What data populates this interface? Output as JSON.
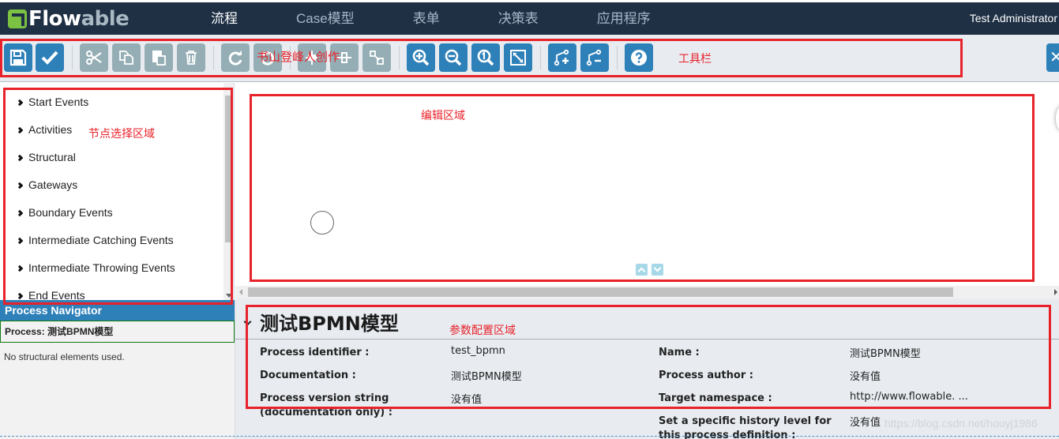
{
  "header": {
    "logo": {
      "part1": "Flow",
      "part2": "able"
    },
    "nav": [
      {
        "label": "流程",
        "active": true
      },
      {
        "label": "Case模型",
        "active": false
      },
      {
        "label": "表单",
        "active": false
      },
      {
        "label": "决策表",
        "active": false
      },
      {
        "label": "应用程序",
        "active": false
      }
    ],
    "user": "Test Administrator"
  },
  "toolbar": {
    "buttons": [
      {
        "name": "save",
        "icon": "save-icon",
        "enabled": true
      },
      {
        "name": "validate",
        "icon": "check-icon",
        "enabled": true
      },
      {
        "name": "cut",
        "icon": "scissors-icon",
        "enabled": false
      },
      {
        "name": "copy",
        "icon": "copy-icon",
        "enabled": false
      },
      {
        "name": "paste",
        "icon": "paste-icon",
        "enabled": false
      },
      {
        "name": "delete",
        "icon": "trash-icon",
        "enabled": false
      },
      {
        "name": "redo",
        "icon": "redo-icon",
        "enabled": false
      },
      {
        "name": "undo",
        "icon": "undo-icon",
        "enabled": false
      },
      {
        "name": "align-horizontal",
        "icon": "align-horizontal-icon",
        "enabled": false
      },
      {
        "name": "align-vertical",
        "icon": "align-vertical-icon",
        "enabled": false
      },
      {
        "name": "same-size",
        "icon": "same-size-icon",
        "enabled": false
      },
      {
        "name": "zoom-in",
        "icon": "zoom-in-icon",
        "enabled": true
      },
      {
        "name": "zoom-out",
        "icon": "zoom-out-icon",
        "enabled": true
      },
      {
        "name": "zoom-actual",
        "icon": "zoom-actual-icon",
        "enabled": true
      },
      {
        "name": "zoom-fit",
        "icon": "zoom-fit-icon",
        "enabled": true
      },
      {
        "name": "add-bendpoint",
        "icon": "bendpoint-add-icon",
        "enabled": true
      },
      {
        "name": "remove-bendpoint",
        "icon": "bendpoint-remove-icon",
        "enabled": true
      },
      {
        "name": "help",
        "icon": "help-icon",
        "enabled": true
      }
    ],
    "close_label": "✕"
  },
  "annotations": {
    "toolbar": "工具栏",
    "watermark_overlay": "书山登峰人创作",
    "palette": "节点选择区域",
    "canvas": "编辑区域",
    "properties": "参数配置区域",
    "color": "#e8222a"
  },
  "palette": {
    "items": [
      "Start Events",
      "Activities",
      "Structural",
      "Gateways",
      "Boundary Events",
      "Intermediate Catching Events",
      "Intermediate Throwing Events",
      "End Events"
    ]
  },
  "navigator": {
    "title": "Process Navigator",
    "process": "Process: 测试BPMN模型",
    "empty_text": "No structural elements used."
  },
  "properties": {
    "title": "测试BPMN模型",
    "left": [
      {
        "label": "Process identifier :",
        "value": "test_bpmn"
      },
      {
        "label": "Documentation :",
        "value": "测试BPMN模型"
      },
      {
        "label": "Process version string (documentation only) :",
        "value": "没有值"
      }
    ],
    "right": [
      {
        "label": "Name :",
        "value": "测试BPMN模型"
      },
      {
        "label": "Process author :",
        "value": "没有值"
      },
      {
        "label": "Target namespace :",
        "value": "http://www.flowable. ..."
      },
      {
        "label": "Set a specific history level for this process definition :",
        "value": "没有值"
      }
    ]
  },
  "watermark": "https://blog.csdn.net/houyj1986",
  "colors": {
    "topbar": "#1f3045",
    "primary": "#2e80b9",
    "disabled": "#95aeb5",
    "brand_green": "#7bc142"
  }
}
